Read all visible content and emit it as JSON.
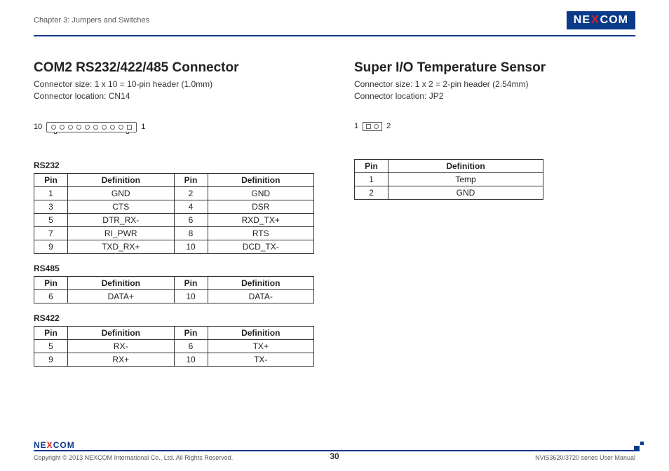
{
  "header": {
    "chapter": "Chapter 3: Jumpers and Switches",
    "logo_pre": "NE",
    "logo_x": "X",
    "logo_post": "COM"
  },
  "left": {
    "title": "COM2 RS232/422/485 Connector",
    "sub1": "Connector size: 1 x 10 = 10-pin header (1.0mm)",
    "sub2": "Connector location: CN14",
    "diag_left": "10",
    "diag_right": "1",
    "tables": {
      "rs232": {
        "label": "RS232",
        "head": [
          "Pin",
          "Definition",
          "Pin",
          "Definition"
        ],
        "rows": [
          [
            "1",
            "GND",
            "2",
            "GND"
          ],
          [
            "3",
            "CTS",
            "4",
            "DSR"
          ],
          [
            "5",
            "DTR_RX-",
            "6",
            "RXD_TX+"
          ],
          [
            "7",
            "RI_PWR",
            "8",
            "RTS"
          ],
          [
            "9",
            "TXD_RX+",
            "10",
            "DCD_TX-"
          ]
        ]
      },
      "rs485": {
        "label": "RS485",
        "head": [
          "Pin",
          "Definition",
          "Pin",
          "Definition"
        ],
        "rows": [
          [
            "6",
            "DATA+",
            "10",
            "DATA-"
          ]
        ]
      },
      "rs422": {
        "label": "RS422",
        "head": [
          "Pin",
          "Definition",
          "Pin",
          "Definition"
        ],
        "rows": [
          [
            "5",
            "RX-",
            "6",
            "TX+"
          ],
          [
            "9",
            "RX+",
            "10",
            "TX-"
          ]
        ]
      }
    }
  },
  "right": {
    "title": "Super I/O Temperature Sensor",
    "sub1": "Connector size: 1 x 2 = 2-pin header (2.54mm)",
    "sub2": "Connector location: JP2",
    "diag_left": "1",
    "diag_right": "2",
    "table": {
      "head": [
        "Pin",
        "Definition"
      ],
      "rows": [
        [
          "1",
          "Temp"
        ],
        [
          "2",
          "GND"
        ]
      ]
    }
  },
  "footer": {
    "logo_pre": "NE",
    "logo_x": "X",
    "logo_post": "COM",
    "copyright": "Copyright © 2013 NEXCOM International Co., Ltd. All Rights Reserved.",
    "page": "30",
    "manual": "NViS3620/3720 series User Manual"
  }
}
